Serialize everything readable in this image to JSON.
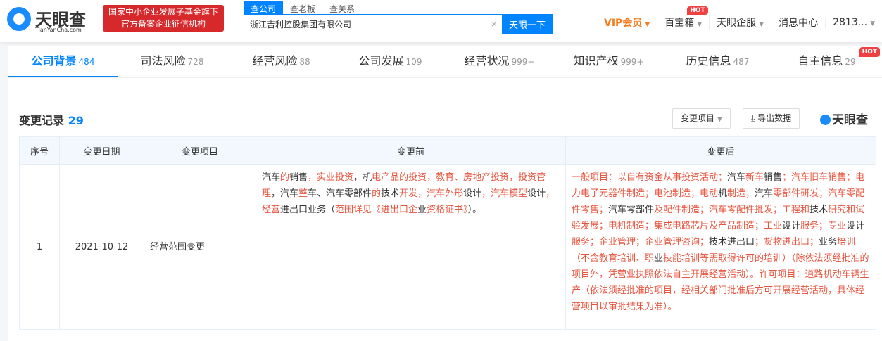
{
  "header": {
    "logo_name": "天眼查",
    "logo_url": "TianYanCha.com",
    "badge_line1": "国家中小企业发展子基金旗下",
    "badge_line2": "官方备案企业征信机构",
    "search_tabs": [
      "查公司",
      "查老板",
      "查关系"
    ],
    "search_value": "浙江吉利控股集团有限公司",
    "search_button": "天眼一下",
    "clear": "×",
    "nav": {
      "vip": "VIP会员",
      "baibao": "百宝箱",
      "qifu": "天眼企服",
      "messages": "消息中心",
      "user": "2813...",
      "hot": "HOT"
    }
  },
  "tabs": [
    {
      "label": "公司背景",
      "count": "484"
    },
    {
      "label": "司法风险",
      "count": "728"
    },
    {
      "label": "经营风险",
      "count": "88"
    },
    {
      "label": "公司发展",
      "count": "109"
    },
    {
      "label": "经营状况",
      "count": "999+"
    },
    {
      "label": "知识产权",
      "count": "999+"
    },
    {
      "label": "历史信息",
      "count": "487"
    },
    {
      "label": "自主信息",
      "count": "29",
      "hot": "HOT"
    }
  ],
  "section": {
    "title": "变更记录",
    "count": "29",
    "filter": "变更项目",
    "export": "导出数据",
    "watermark": "天眼查"
  },
  "table": {
    "headers": [
      "序号",
      "变更日期",
      "变更项目",
      "变更前",
      "变更后"
    ],
    "rows": [
      {
        "index": "1",
        "date": "2021-10-12",
        "item": "经营范围变更",
        "before": [
          [
            "汽车",
            0
          ],
          [
            "的",
            1
          ],
          [
            "销售",
            0
          ],
          [
            "，实业投资",
            1
          ],
          [
            "，机",
            0
          ],
          [
            "电产品的投资，教育、房地产投资，投资管理",
            1
          ],
          [
            "，汽车",
            0
          ],
          [
            "整",
            1
          ],
          [
            "车、汽车零部件",
            0
          ],
          [
            "的",
            1
          ],
          [
            "技术",
            0
          ],
          [
            "开发，汽车外形",
            1
          ],
          [
            "设计",
            0
          ],
          [
            "，汽车模型",
            1
          ],
          [
            "设计",
            0
          ],
          [
            "，经营",
            1
          ],
          [
            "进出口业务（",
            0
          ],
          [
            "范围详见《进出口企",
            1
          ],
          [
            "业",
            0
          ],
          [
            "资格证书》",
            1
          ],
          [
            "）。",
            0
          ]
        ],
        "after": [
          [
            "一般项目：以自有资金从事投资活动；",
            1
          ],
          [
            "汽车",
            0
          ],
          [
            "新车",
            1
          ],
          [
            "销售",
            0
          ],
          [
            "；汽车旧车销售；电力电子元器件制造；电池制造；电动",
            1
          ],
          [
            "机",
            0
          ],
          [
            "制造；",
            1
          ],
          [
            "汽车",
            0
          ],
          [
            "零部件研发；汽车零配件零售；",
            1
          ],
          [
            "汽车零部件",
            0
          ],
          [
            "及配件制造；汽车零配件批发；工程和",
            1
          ],
          [
            "技术",
            0
          ],
          [
            "研究和试验发展；电机制造；集成电路芯片及产品制造；工业",
            1
          ],
          [
            "设计",
            0
          ],
          [
            "服务；专业",
            1
          ],
          [
            "设计",
            0
          ],
          [
            "服务；企业管理；企业管理咨询；",
            1
          ],
          [
            "技术进出口",
            0
          ],
          [
            "；货物进出口；",
            1
          ],
          [
            "业务",
            0
          ],
          [
            "培训（不含教育培训、职",
            1
          ],
          [
            "业",
            0
          ],
          [
            "技能培训等需取得许可的培训）（除依法须经批准的项目外，凭营业执照依法自主开展经营活动）。许可项目：道路机动车辆生产（依法须经批准的项目，经相关部门批准后方可开展经营活动，具体经营项目以审批结果为准）。",
            1
          ]
        ]
      }
    ]
  },
  "colors": {
    "accent": "#0084ff",
    "highlight": "#e8553f",
    "vip": "#f57c1f",
    "hot": "#f04142"
  }
}
